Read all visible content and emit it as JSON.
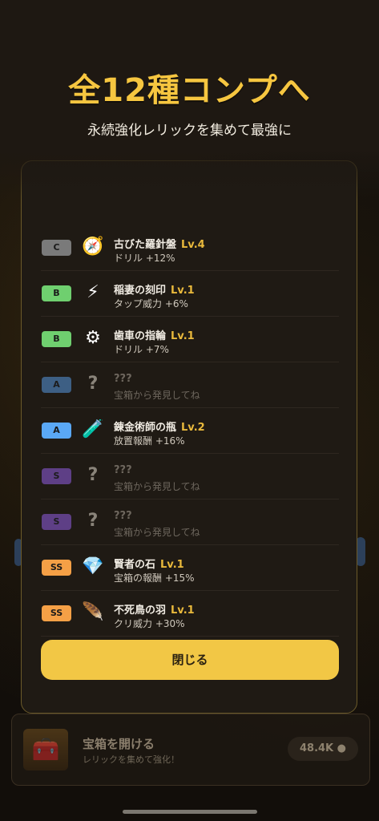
{
  "promo": {
    "title": "全12種コンプへ",
    "subtitle": "永続強化レリックを集めて最強に"
  },
  "relic_list": [
    {
      "rank": "C",
      "rank_color": "#7a7a7a",
      "icon": "compass-icon",
      "glyph": "🧭",
      "name": "古びた羅針盤",
      "level": "Lv.4",
      "desc": "ドリル +12%",
      "locked": false
    },
    {
      "rank": "B",
      "rank_color": "#6fcf6f",
      "icon": "lightning-icon",
      "glyph": "⚡",
      "name": "稲妻の刻印",
      "level": "Lv.1",
      "desc": "タップ威力 +6%",
      "locked": false
    },
    {
      "rank": "B",
      "rank_color": "#6fcf6f",
      "icon": "gear-icon",
      "glyph": "⚙",
      "name": "歯車の指輪",
      "level": "Lv.1",
      "desc": "ドリル +7%",
      "locked": false
    },
    {
      "rank": "A",
      "rank_color": "#3d5f84",
      "icon": "question-icon",
      "glyph": "?",
      "name": "???",
      "level": "",
      "desc": "宝箱から発見してね",
      "locked": true
    },
    {
      "rank": "A",
      "rank_color": "#5aa8f5",
      "icon": "potion-flask-icon",
      "glyph": "🧪",
      "name": "錬金術師の瓶",
      "level": "Lv.2",
      "desc": "放置報酬 +16%",
      "locked": false
    },
    {
      "rank": "S",
      "rank_color": "#5e3f86",
      "icon": "question-icon",
      "glyph": "?",
      "name": "???",
      "level": "",
      "desc": "宝箱から発見してね",
      "locked": true
    },
    {
      "rank": "S",
      "rank_color": "#5e3f86",
      "icon": "question-icon",
      "glyph": "?",
      "name": "???",
      "level": "",
      "desc": "宝箱から発見してね",
      "locked": true
    },
    {
      "rank": "SS",
      "rank_color": "#f5a046",
      "icon": "gem-icon",
      "glyph": "💎",
      "name": "賢者の石",
      "level": "Lv.1",
      "desc": "宝箱の報酬 +15%",
      "locked": false
    },
    {
      "rank": "SS",
      "rank_color": "#f5a046",
      "icon": "feather-icon",
      "glyph": "🪶",
      "name": "不死鳥の羽",
      "level": "Lv.1",
      "desc": "クリ威力 +30%",
      "locked": false
    }
  ],
  "modal": {
    "close_label": "閉じる"
  },
  "chest": {
    "title": "宝箱を開ける",
    "subtitle": "レリックを集めて強化！",
    "price": "48.4K"
  }
}
